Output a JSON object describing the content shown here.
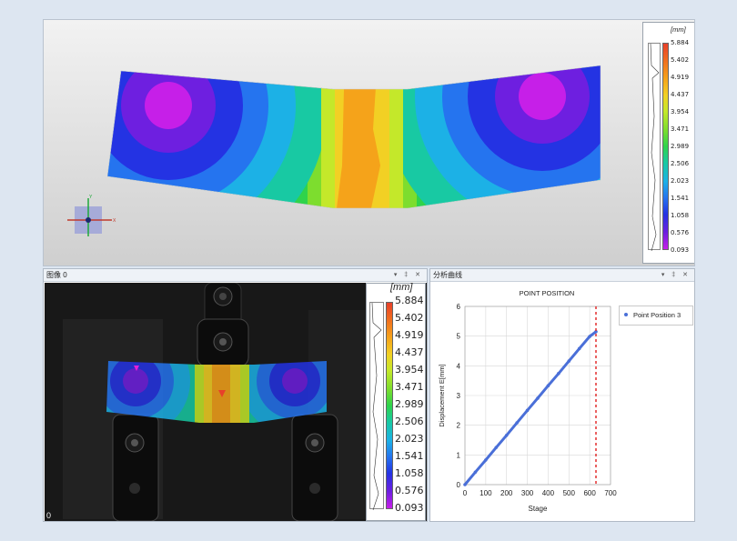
{
  "legend": {
    "unit": "[mm]",
    "levels": [
      "5.884",
      "5.402",
      "4.919",
      "4.437",
      "3.954",
      "3.471",
      "2.989",
      "2.506",
      "2.023",
      "1.541",
      "1.058",
      "0.576",
      "0.093"
    ],
    "colors": [
      "#e8402a",
      "#f06d1f",
      "#f5a31a",
      "#f2d024",
      "#c4e82a",
      "#7ddd2e",
      "#2fd34b",
      "#18c9a3",
      "#1cb1e6",
      "#2574ef",
      "#2433e3",
      "#6e1fe0",
      "#c61fe8"
    ]
  },
  "panels": {
    "image": {
      "title": "图像 0",
      "index": "0"
    },
    "analysis": {
      "title": "分析曲线"
    },
    "controls": "▾ ‡ ✕"
  },
  "chart_data": {
    "type": "scatter",
    "title": "POINT POSITION",
    "xlabel": "Stage",
    "ylabel": "Displacement E[mm]",
    "xlim": [
      0,
      700
    ],
    "ylim": [
      0,
      6
    ],
    "xticks": [
      0,
      100,
      200,
      300,
      400,
      500,
      600,
      700
    ],
    "yticks": [
      0,
      1,
      2,
      3,
      4,
      5,
      6
    ],
    "grid": true,
    "legend_position": "top-right",
    "marker_line_x": 630,
    "series": [
      {
        "name": "Point Position 3",
        "color": "#4a6fd8",
        "x": [
          0,
          50,
          100,
          150,
          200,
          250,
          300,
          350,
          400,
          450,
          500,
          550,
          600,
          630
        ],
        "y": [
          0,
          0.42,
          0.83,
          1.25,
          1.66,
          2.08,
          2.5,
          2.91,
          3.33,
          3.74,
          4.16,
          4.58,
          4.99,
          5.15
        ]
      }
    ]
  }
}
